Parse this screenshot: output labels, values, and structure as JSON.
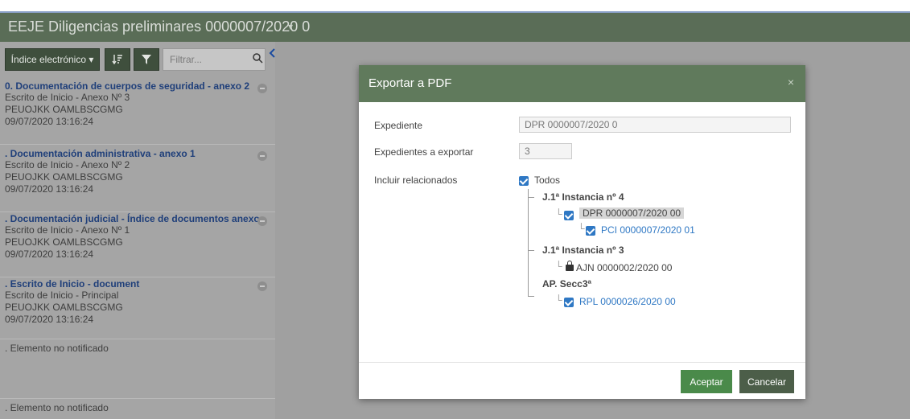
{
  "header": {
    "title": "EEJE Diligencias preliminares 0000007/2020 0",
    "caret": "▾"
  },
  "toolbar": {
    "index_button": "Índice electrónico ▾",
    "sort_icon": "sort-icon",
    "filter_icon": "filter-icon",
    "filter_placeholder": "Filtrar...",
    "search_icon": "search-icon",
    "collapse_icon": "chevron-left-icon"
  },
  "documents": [
    {
      "title": "0. Documentación de cuerpos de seguridad - anexo 2",
      "line1": "Escrito de Inicio - Anexo Nº 3",
      "line2": "PEUOJKK OAMLBSCGMG",
      "line3": "09/07/2020 13:16:24"
    },
    {
      "title": ". Documentación administrativa - anexo 1",
      "line1": "Escrito de Inicio - Anexo Nº 2",
      "line2": "PEUOJKK OAMLBSCGMG",
      "line3": "09/07/2020 13:16:24"
    },
    {
      "title": ". Documentación judicial - Índice de documentos anexos",
      "line1": "Escrito de Inicio - Anexo Nº 1",
      "line2": "PEUOJKK OAMLBSCGMG",
      "line3": "09/07/2020 13:16:24"
    },
    {
      "title": ". Escrito de Inicio - document",
      "line1": "Escrito de Inicio - Principal",
      "line2": "PEUOJKK OAMLBSCGMG",
      "line3": "09/07/2020 13:16:24"
    },
    {
      "title": "",
      "line1": ". Elemento no notificado",
      "line2": "",
      "line3": ""
    },
    {
      "title": "",
      "line1": ". Elemento no notificado",
      "line2": "",
      "line3": ""
    }
  ],
  "modal": {
    "title": "Exportar a PDF",
    "close": "×",
    "expediente_label": "Expediente",
    "expediente_value": "DPR 0000007/2020 0",
    "count_label": "Expedientes a exportar",
    "count_value": "3",
    "related_label": "Incluir relacionados",
    "all_label": "Todos",
    "tree": {
      "court1": "J.1ª Instancia nº 4",
      "dpr": "DPR 0000007/2020 00",
      "pci": "PCI 0000007/2020 01",
      "court2": "J.1ª Instancia nº 3",
      "ajn": "AJN 0000002/2020 00",
      "court3": "AP. Secc3ª",
      "rpl": "RPL 0000026/2020 00",
      "branch": "└"
    },
    "accept": "Aceptar",
    "cancel": "Cancelar"
  },
  "colors": {
    "header_bg": "#5a6d57",
    "modal_header_bg": "#607a5c",
    "accept_bg": "#4a8a4a",
    "cancel_bg": "#4c5e49",
    "link": "#2f78c4"
  }
}
